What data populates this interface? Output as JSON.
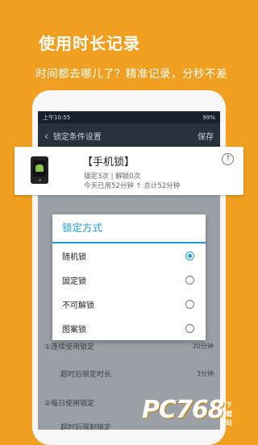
{
  "promo": {
    "headline": "使用时长记录",
    "sub": "时间都去哪儿了？精准记录，分秒不差"
  },
  "status": {
    "time": "上午10:55",
    "battery": "99%"
  },
  "appbar": {
    "back_icon": "chevron-left-icon",
    "title": "锁定条件设置",
    "action": "保存"
  },
  "card": {
    "name": "【手机锁】",
    "stats": "锁定3次 | 解锁0次",
    "today": "今天已用52分钟 ↑  总计52分钟",
    "help": "?"
  },
  "dialog": {
    "title": "锁定方式",
    "options": [
      {
        "label": "随机锁",
        "selected": true
      },
      {
        "label": "固定锁",
        "selected": false
      },
      {
        "label": "不可解锁",
        "selected": false
      },
      {
        "label": "图案锁",
        "selected": false
      }
    ]
  },
  "bg_rows": [
    {
      "label": "①连续使用锁定",
      "value": "20分钟"
    },
    {
      "label": "超时后锁定时长",
      "value": "3分钟"
    },
    {
      "label": "②每日使用锁定",
      "value": ""
    },
    {
      "label": "超时后强制锁定",
      "value": ""
    }
  ],
  "logo": {
    "text": "PC768",
    "small": "下载站"
  },
  "colors": {
    "accent": "#1f9ad6",
    "background": "#f0a020"
  }
}
